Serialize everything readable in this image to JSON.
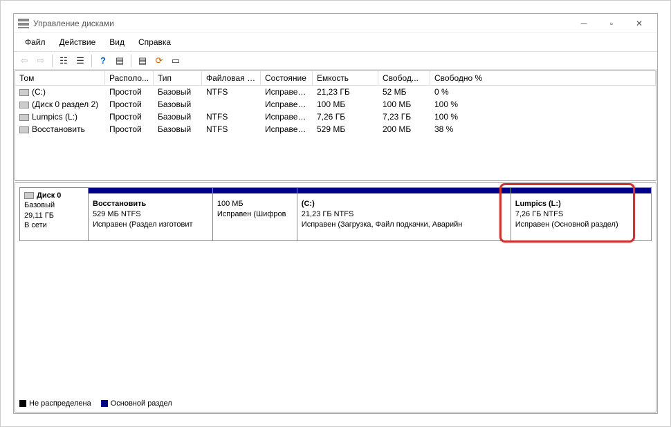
{
  "window": {
    "title": "Управление дисками"
  },
  "menubar": {
    "file": "Файл",
    "action": "Действие",
    "view": "Вид",
    "help": "Справка"
  },
  "columns": [
    "Том",
    "Располо...",
    "Тип",
    "Файловая с...",
    "Состояние",
    "Емкость",
    "Свобод...",
    "Свободно %"
  ],
  "volumes": [
    {
      "name": "(C:)",
      "layout": "Простой",
      "type": "Базовый",
      "fs": "NTFS",
      "status": "Исправен...",
      "capacity": "21,23 ГБ",
      "free": "52 МБ",
      "freepct": "0 %"
    },
    {
      "name": "(Диск 0 раздел 2)",
      "layout": "Простой",
      "type": "Базовый",
      "fs": "",
      "status": "Исправен...",
      "capacity": "100 МБ",
      "free": "100 МБ",
      "freepct": "100 %"
    },
    {
      "name": "Lumpics (L:)",
      "layout": "Простой",
      "type": "Базовый",
      "fs": "NTFS",
      "status": "Исправен...",
      "capacity": "7,26 ГБ",
      "free": "7,23 ГБ",
      "freepct": "100 %"
    },
    {
      "name": "Восстановить",
      "layout": "Простой",
      "type": "Базовый",
      "fs": "NTFS",
      "status": "Исправен...",
      "capacity": "529 МБ",
      "free": "200 МБ",
      "freepct": "38 %"
    }
  ],
  "disk": {
    "label": "Диск 0",
    "type": "Базовый",
    "size": "29,11 ГБ",
    "online": "В сети",
    "partitions": [
      {
        "title": "Восстановить",
        "sub": "529 МБ NTFS",
        "status": "Исправен (Раздел изготовит"
      },
      {
        "title": "",
        "sub": "100 МБ",
        "status": "Исправен (Шифров"
      },
      {
        "title": "(C:)",
        "sub": "21,23 ГБ NTFS",
        "status": "Исправен (Загрузка, Файл подкачки, Аварийн"
      },
      {
        "title": "Lumpics  (L:)",
        "sub": "7,26 ГБ NTFS",
        "status": "Исправен (Основной раздел)"
      }
    ]
  },
  "legend": {
    "unalloc": "Не распределена",
    "primary": "Основной раздел"
  }
}
